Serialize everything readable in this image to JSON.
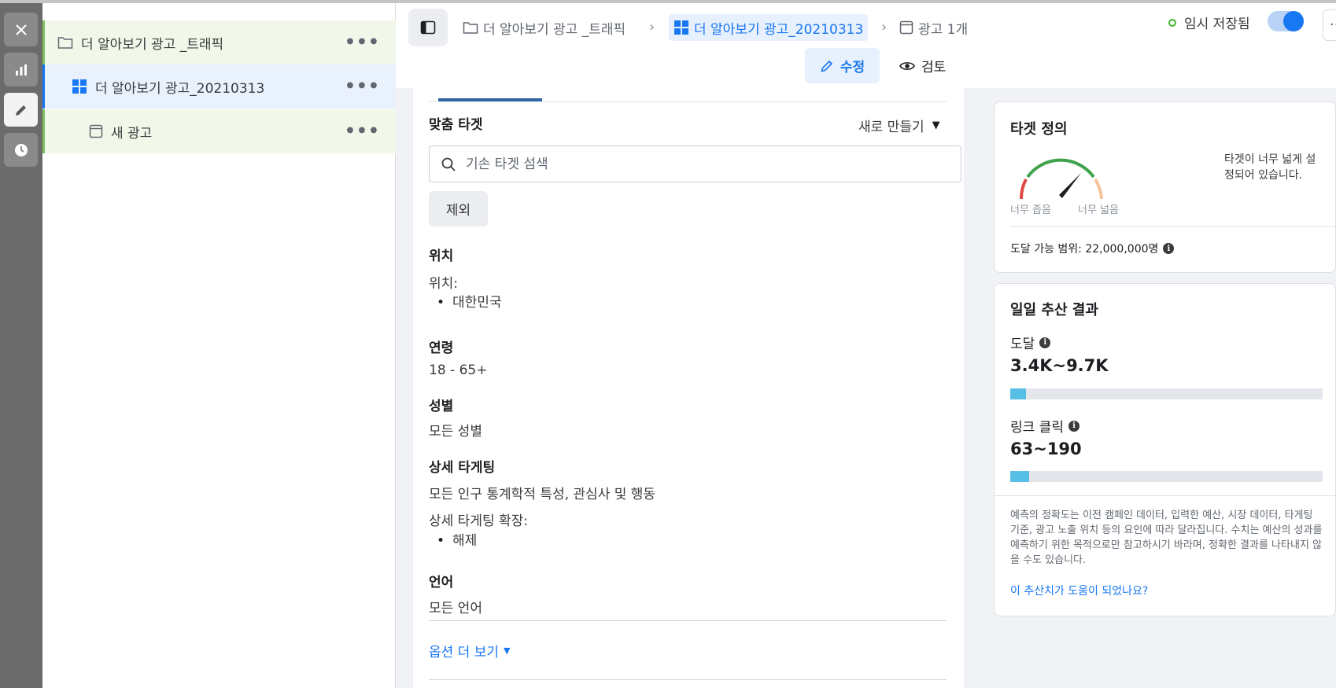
{
  "tree": {
    "campaign": "더 알아보기 광고 _트래픽",
    "adset": "더 알아보기 광고_20210313",
    "ad": "새 광고",
    "more": "•••"
  },
  "header": {
    "breadcrumb": [
      "더 알아보기 광고 _트래픽",
      "더 알아보기 광고_20210313",
      "광고 1개"
    ],
    "saved_status": "임시 저장됨",
    "edit_label": "수정",
    "review_label": "검토"
  },
  "form": {
    "custom_audience_title": "맞춤 타겟",
    "create_new": "새로 만들기",
    "search_placeholder": "기손 타겟 섬색",
    "exclude": "제외",
    "location_title": "위치",
    "location_label": "위치:",
    "location_value": "대한민국",
    "age_title": "연령",
    "age_value": "18 - 65+",
    "gender_title": "성별",
    "gender_value": "모든 성별",
    "detailed_title": "상세 타게팅",
    "detailed_value": "모든 인구 통계학적 특성, 관심사 및 행동",
    "detailed_expansion_label": "상세 타게팅 확장:",
    "detailed_expansion_value": "해제",
    "language_title": "언어",
    "language_value": "모든 언어",
    "more_options": "옵션 더 보기"
  },
  "audience_definition": {
    "title": "타겟 정의",
    "gauge_narrow": "너무 좁음",
    "gauge_broad": "너무 넓음",
    "description": "타겟이 너무 넓게 설정되어 있습니다.",
    "reach": "도달 가능 범위: 22,000,000명"
  },
  "daily_estimate": {
    "title": "일일 추산 결과",
    "reach_label": "도달",
    "reach_value": "3.4K~9.7K",
    "reach_fill": 0.05,
    "clicks_label": "링크 클릭",
    "clicks_value": "63~190",
    "clicks_fill": 0.06,
    "disclaimer": "예측의 정확도는 이전 캠페인 데이터, 입력한 예산, 시장 데이터, 타게팅 기준, 광고 노출 위치 등의 요인에 따라 달라집니다. 수치는 예산의 성과를 예측하기 위한 목적으로만 참고하시기 바라며, 정확한 결과를 나타내지 않을 수도 있습니다.",
    "helpful_link": "이 추산치가 도움이 되었나요?"
  },
  "colors": {
    "accent": "#1877f2",
    "tree_selected": "#e9f1fd",
    "tree_green": "#f1f8ea",
    "bar_fill": "#57bee6"
  }
}
